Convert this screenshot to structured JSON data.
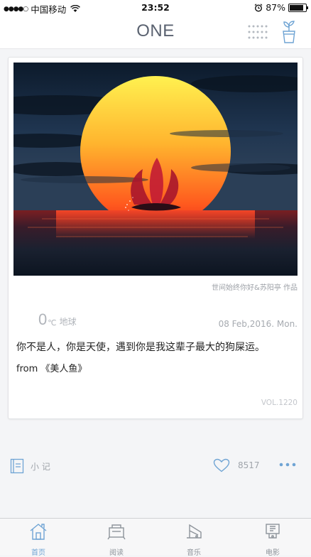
{
  "status_bar": {
    "signal": "●●●●○",
    "carrier": "中国移动",
    "time": "23:52",
    "battery": "87%",
    "battery_level": 0.87
  },
  "nav": {
    "title": "ONE"
  },
  "card": {
    "photo_credit": "世间始终你好&苏阳亭 作品",
    "temperature": "0",
    "temperature_unit": "℃",
    "location": "地球",
    "date": "08 Feb,2016. Mon.",
    "quote": "你不是人，你是天使，遇到你是我这辈子最大的狗屎运。",
    "source": "from 《美人鱼》",
    "volume": "VOL.1220"
  },
  "actions": {
    "note_label": "小 记",
    "like_count": "8517"
  },
  "tabs": [
    {
      "label": "首页",
      "active": true
    },
    {
      "label": "阅读",
      "active": false
    },
    {
      "label": "音乐",
      "active": false
    },
    {
      "label": "电影",
      "active": false
    }
  ],
  "colors": {
    "accent": "#6fa4d4",
    "title": "#5a6270",
    "muted": "#a0a5ab",
    "background": "#f4f5f7"
  },
  "icons": {
    "grid": "grid-icon",
    "plant": "plant-icon",
    "note": "note-icon",
    "heart": "heart-icon",
    "more": "more-icon",
    "home": "home-icon",
    "read": "book-icon",
    "music": "music-icon",
    "movie": "movie-icon"
  }
}
